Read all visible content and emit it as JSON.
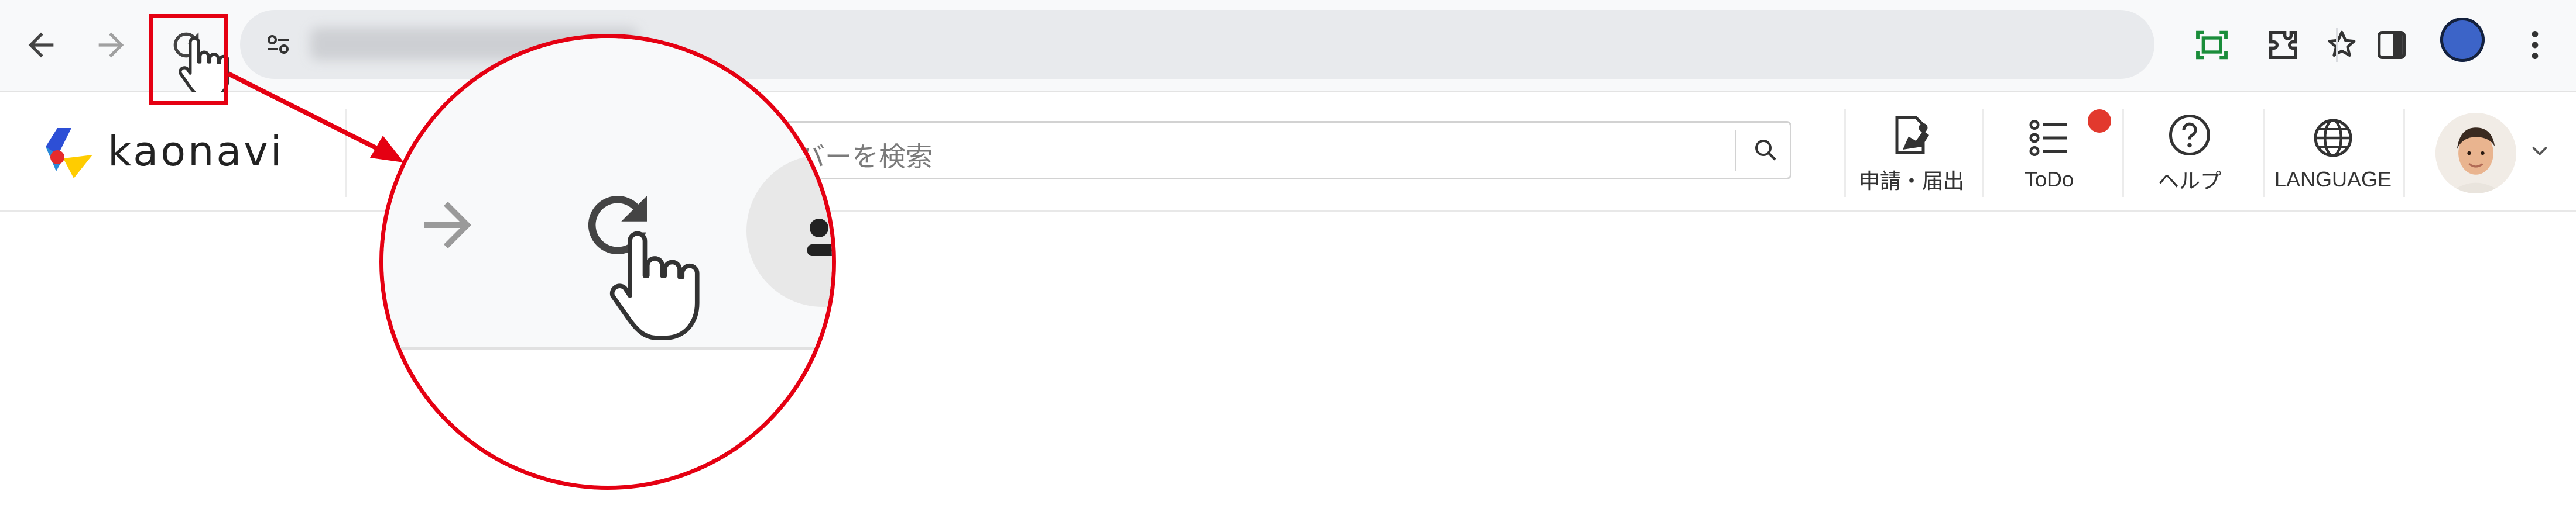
{
  "browser": {
    "back_icon": "arrow-left-icon",
    "forward_icon": "arrow-right-icon",
    "reload_icon": "reload-icon",
    "cursor_icon": "hand-pointer-icon",
    "url": "",
    "site_info_icon": "tune-icon",
    "bookmark_icon": "star-icon",
    "toolbar_icons": [
      "screenshot-icon",
      "extensions-icon",
      "side-panel-icon",
      "profile-icon",
      "more-vert-icon"
    ],
    "accent_color": "#1a8d3a"
  },
  "annotation": {
    "color": "#e50012",
    "highlight_target": "reload-button",
    "magnifier_icons": [
      "arrow-right-icon",
      "reload-icon",
      "hand-pointer-icon"
    ]
  },
  "app": {
    "logo_text": "kaonavi",
    "search_placeholder": "バーを検索",
    "nav": [
      {
        "label": "申請・届出",
        "icon": "application-form-icon"
      },
      {
        "label": "ToDo",
        "icon": "todo-list-icon",
        "badge": true
      },
      {
        "label": "ヘルプ",
        "icon": "help-icon"
      },
      {
        "label": "LANGUAGE",
        "icon": "globe-icon"
      }
    ],
    "badge_color": "#e2392e"
  }
}
